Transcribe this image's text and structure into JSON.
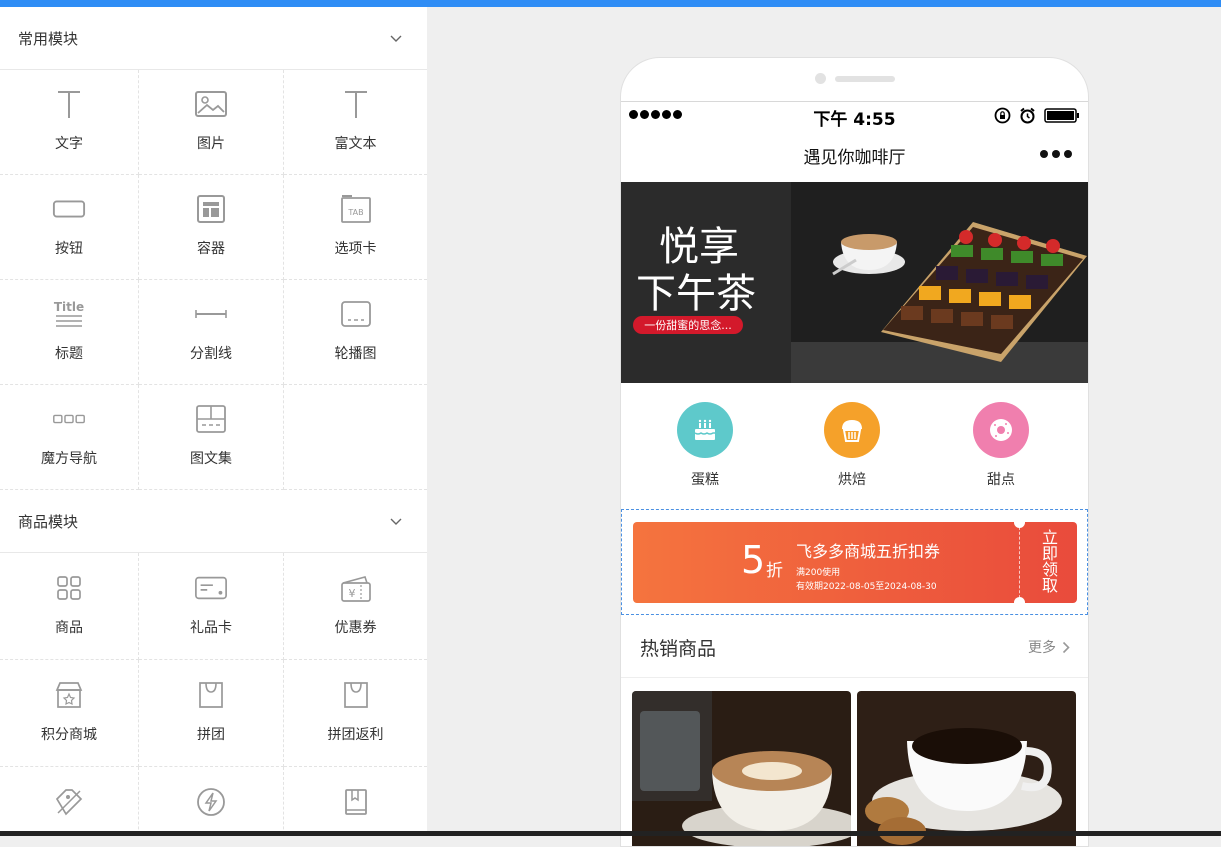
{
  "sidebar": {
    "common_section": {
      "title": "常用模块",
      "items": [
        {
          "label": "文字",
          "icon": "text-icon"
        },
        {
          "label": "图片",
          "icon": "image-icon"
        },
        {
          "label": "富文本",
          "icon": "rich-text-icon"
        },
        {
          "label": "按钮",
          "icon": "button-icon"
        },
        {
          "label": "容器",
          "icon": "container-icon"
        },
        {
          "label": "选项卡",
          "icon": "tab-icon"
        },
        {
          "label": "标题",
          "icon": "title-icon"
        },
        {
          "label": "分割线",
          "icon": "divider-icon"
        },
        {
          "label": "轮播图",
          "icon": "carousel-icon"
        },
        {
          "label": "魔方导航",
          "icon": "cube-nav-icon"
        },
        {
          "label": "图文集",
          "icon": "image-text-icon"
        }
      ]
    },
    "goods_section": {
      "title": "商品模块",
      "items": [
        {
          "label": "商品",
          "icon": "goods-icon"
        },
        {
          "label": "礼品卡",
          "icon": "gift-card-icon"
        },
        {
          "label": "优惠券",
          "icon": "coupon-icon"
        },
        {
          "label": "积分商城",
          "icon": "points-mall-icon"
        },
        {
          "label": "拼团",
          "icon": "group-buy-icon"
        },
        {
          "label": "拼团返利",
          "icon": "group-rebate-icon"
        },
        {
          "label": "",
          "icon": "discount-tag-icon"
        },
        {
          "label": "",
          "icon": "flash-sale-icon"
        },
        {
          "label": "",
          "icon": "book-icon"
        }
      ]
    }
  },
  "phone": {
    "status": {
      "time": "下午 4:55"
    },
    "nav_title": "遇见你咖啡厅",
    "banner": {
      "headline_1": "悦享",
      "headline_2": "下午茶",
      "tagline": "一份甜蜜的思念..."
    },
    "categories": [
      {
        "label": "蛋糕",
        "color": "#5ec9cb"
      },
      {
        "label": "烘焙",
        "color": "#f5a12a"
      },
      {
        "label": "甜点",
        "color": "#f07fae"
      }
    ],
    "coupon": {
      "number": "5",
      "unit": "折",
      "title": "飞多多商城五折扣券",
      "condition": "满200使用",
      "validity": "有效期2022-08-05至2024-08-30",
      "button": "立即领取"
    },
    "hot": {
      "title": "热销商品",
      "more": "更多"
    }
  },
  "colors": {
    "accent": "#2f8df5",
    "coupon_start": "#f5743e",
    "coupon_end": "#e94b3c"
  }
}
